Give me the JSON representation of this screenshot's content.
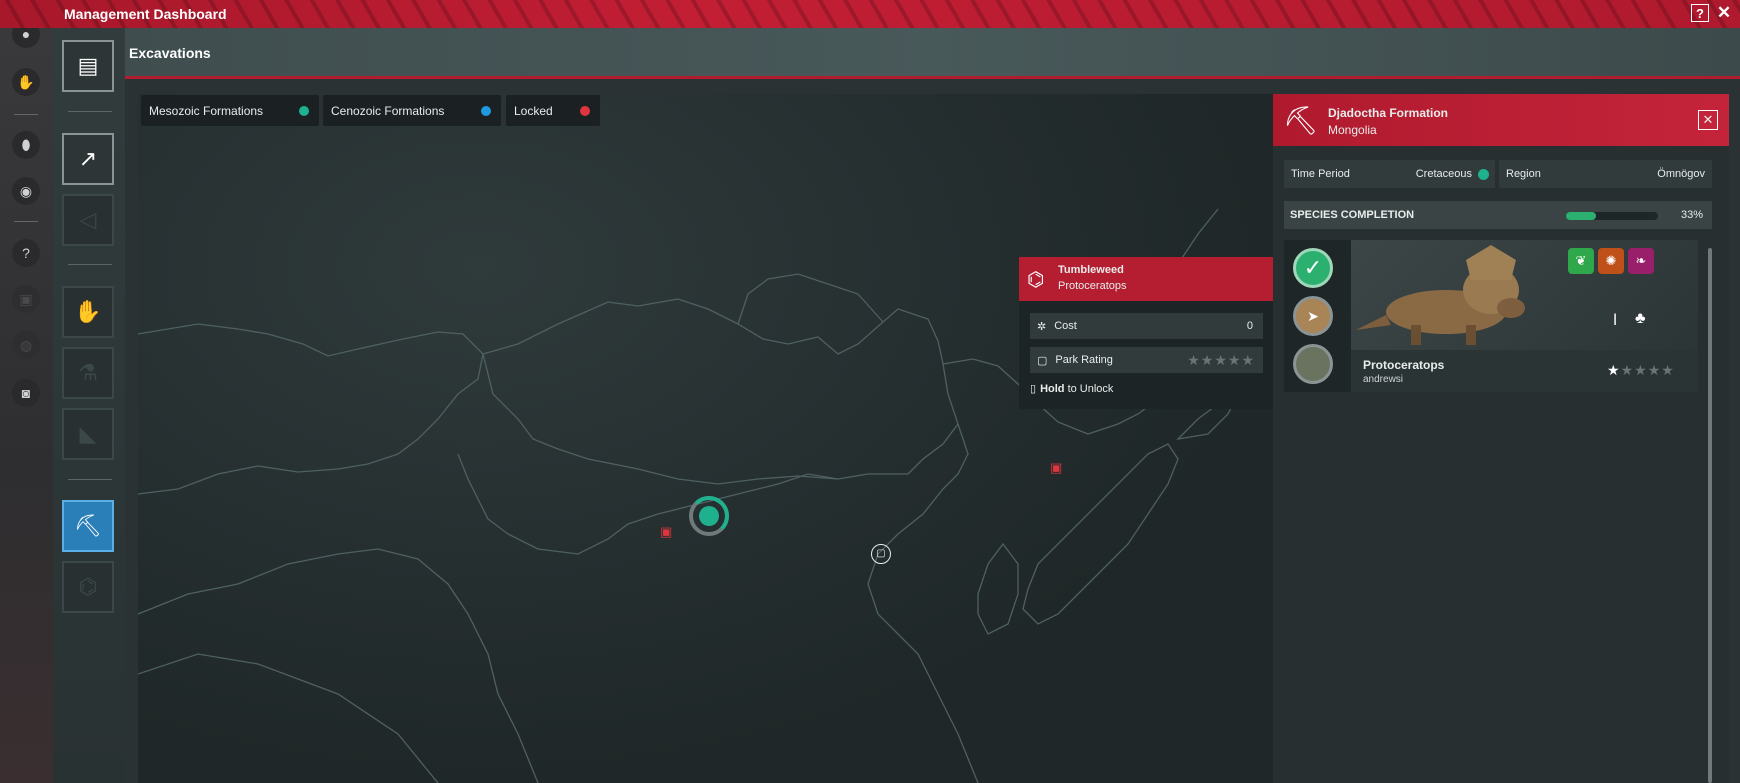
{
  "window": {
    "title": "Management Dashboard",
    "help_label": "?",
    "close_label": "✕"
  },
  "page": {
    "subtitle": "Excavations"
  },
  "legend": [
    {
      "label": "Mesozoic Formations",
      "color": "#1fb08e"
    },
    {
      "label": "Cenozoic Formations",
      "color": "#1e9be0"
    },
    {
      "label": "Locked",
      "color": "#e0343e"
    }
  ],
  "tooltip": {
    "title": "Tumbleweed",
    "subtitle": "Protoceratops",
    "cost_label": "Cost",
    "cost_value": "0",
    "rating_label": "Park Rating",
    "rating_stars": 0,
    "hold_bold": "Hold",
    "hold_rest": " to Unlock"
  },
  "panel": {
    "formation_name": "Djadoctha Formation",
    "country": "Mongolia",
    "close_label": "✕",
    "time_period_label": "Time Period",
    "time_period_value": "Cretaceous",
    "time_period_color": "#1fb08e",
    "region_label": "Region",
    "region_value": "Ömnögov",
    "species_label": "SPECIES COMPLETION",
    "species_percent_label": "33%",
    "species_percent": 0.33
  },
  "species": {
    "name": "Protoceratops",
    "subname": "andrewsi",
    "rating_stars": 1,
    "trait_colors": [
      "#2ea84a",
      "#c0501a",
      "#9a1f6a"
    ]
  },
  "colors": {
    "accent_red": "#b51d31",
    "active_tab": "#2a7fb8",
    "progress": "#2bb070"
  }
}
